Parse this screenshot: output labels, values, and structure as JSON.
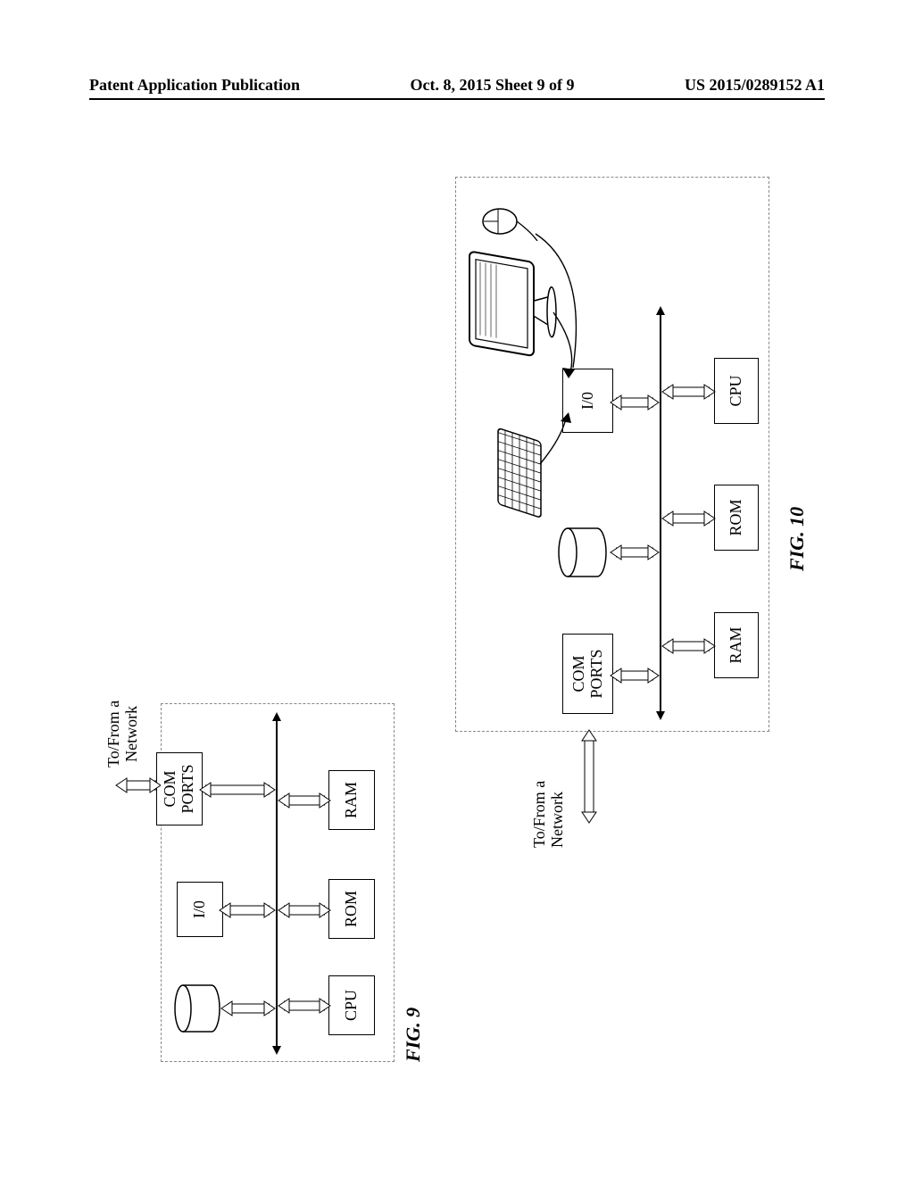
{
  "header": {
    "left": "Patent Application Publication",
    "center": "Oct. 8, 2015   Sheet 9 of 9",
    "right": "US 2015/0289152 A1"
  },
  "fig9": {
    "label": "FIG. 9",
    "network_label": "To/From a\nNetwork",
    "boxes": {
      "com_ports": "COM\nPORTS",
      "io": "I/0",
      "ram": "RAM",
      "rom": "ROM",
      "cpu": "CPU"
    }
  },
  "fig10": {
    "label": "FIG. 10",
    "network_label": "To/From a\nNetwork",
    "boxes": {
      "com_ports": "COM\nPORTS",
      "io": "I/0",
      "ram": "RAM",
      "rom": "ROM",
      "cpu": "CPU"
    }
  }
}
